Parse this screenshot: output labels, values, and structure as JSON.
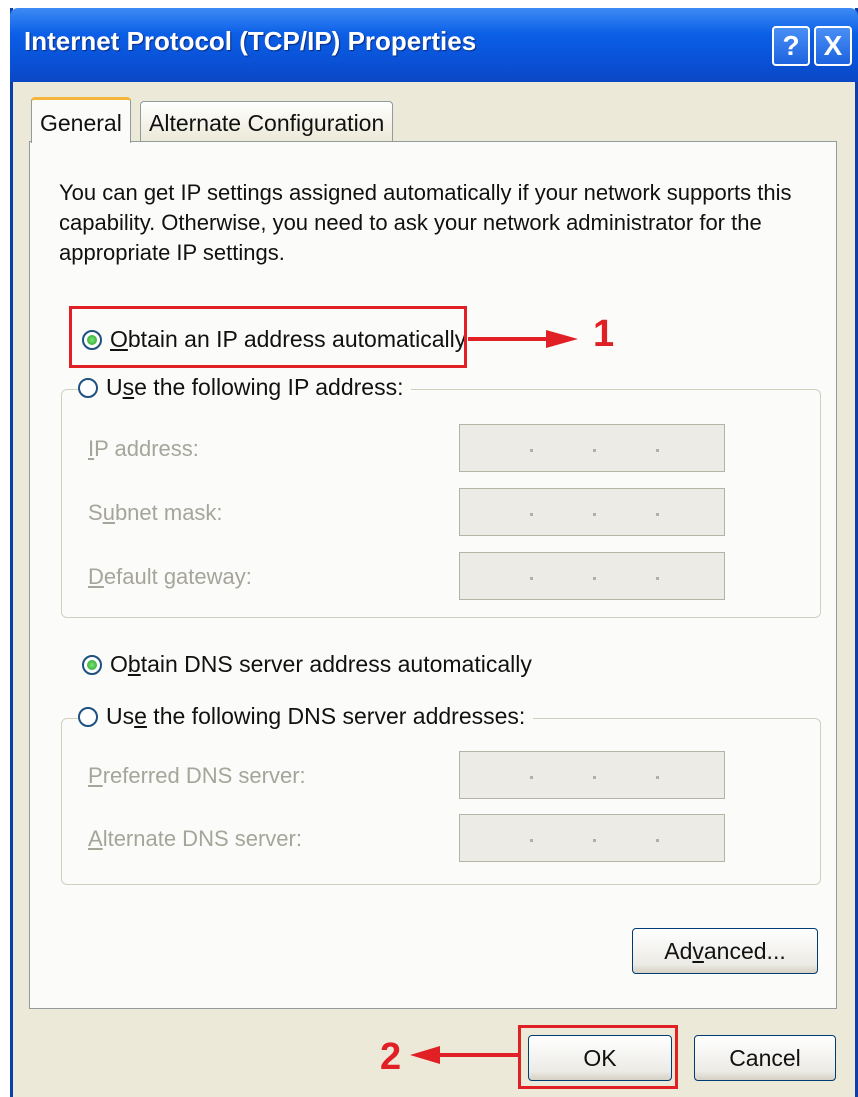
{
  "window": {
    "title": "Internet Protocol (TCP/IP) Properties",
    "help_button": "?",
    "close_button": "X"
  },
  "tabs": [
    {
      "label": "General",
      "active": true
    },
    {
      "label": "Alternate Configuration",
      "active": false
    }
  ],
  "description": "You can get IP settings assigned automatically if your network supports this capability. Otherwise, you need to ask your network administrator for the appropriate IP settings.",
  "ip_section": {
    "auto_option": {
      "prefix": "",
      "mnemonic": "O",
      "suffix": "btain an IP address automatically",
      "selected": true
    },
    "manual_option": {
      "prefix": "U",
      "mnemonic": "s",
      "suffix": "e the following IP address:",
      "selected": false
    },
    "fields": [
      {
        "prefix": "",
        "mnemonic": "I",
        "suffix": "P address:"
      },
      {
        "prefix": "S",
        "mnemonic": "u",
        "suffix": "bnet mask:"
      },
      {
        "prefix": "",
        "mnemonic": "D",
        "suffix": "efault gateway:"
      }
    ]
  },
  "dns_section": {
    "auto_option": {
      "prefix": "O",
      "mnemonic": "b",
      "suffix": "tain DNS server address automatically",
      "selected": true
    },
    "manual_option": {
      "prefix": "Us",
      "mnemonic": "e",
      "suffix": " the following DNS server addresses:",
      "selected": false
    },
    "fields": [
      {
        "prefix": "",
        "mnemonic": "P",
        "suffix": "referred DNS server:"
      },
      {
        "prefix": "",
        "mnemonic": "A",
        "suffix": "lternate DNS server:"
      }
    ]
  },
  "buttons": {
    "advanced": {
      "prefix": "Ad",
      "mnemonic": "v",
      "suffix": "anced..."
    },
    "ok": "OK",
    "cancel": "Cancel"
  },
  "annotations": {
    "callout_1": "1",
    "callout_2": "2",
    "highlight_color": "#e02024"
  },
  "colors": {
    "titlebar": "#0a52d8",
    "dialog_bg": "#ece9d8",
    "panel_bg": "#fbfbf9",
    "radio_selected": "#21a121"
  }
}
